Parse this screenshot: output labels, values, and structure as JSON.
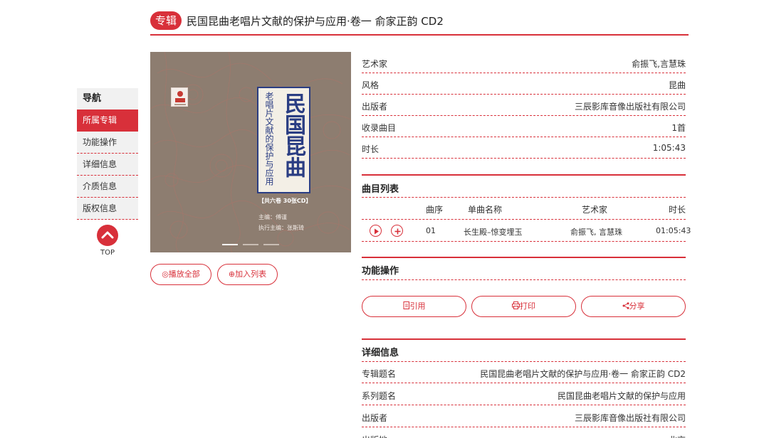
{
  "header": {
    "badge": "专辑",
    "title": "民国昆曲老唱片文献的保护与应用·卷一 俞家正韵 CD2"
  },
  "sidenav": {
    "heading": "导航",
    "items": [
      {
        "label": "所属专辑",
        "active": true
      },
      {
        "label": "功能操作",
        "active": false
      },
      {
        "label": "详细信息",
        "active": false
      },
      {
        "label": "介质信息",
        "active": false
      },
      {
        "label": "版权信息",
        "active": false
      }
    ],
    "top_label": "TOP"
  },
  "cover": {
    "main_title": "民国昆曲",
    "side_title": "老唱片文献的保护与应用",
    "volume": "【共六卷 30张CD】",
    "editor": "主编：傅谨",
    "exec_editor": "执行主编：张斯琦",
    "slides_total": 3,
    "active_slide": 1
  },
  "actions": {
    "play_all": "◎播放全部",
    "add_list": "⊕加入列表"
  },
  "info_rows": [
    {
      "key": "艺术家",
      "value": "俞振飞,言慧珠"
    },
    {
      "key": "风格",
      "value": "昆曲"
    },
    {
      "key": "出版者",
      "value": "三辰影库音像出版社有限公司"
    },
    {
      "key": "收录曲目",
      "value": "1首"
    },
    {
      "key": "时长",
      "value": "1:05:43"
    }
  ],
  "tracklist": {
    "title": "曲目列表",
    "headers": {
      "no": "曲序",
      "name": "单曲名称",
      "artist": "艺术家",
      "duration": "时长"
    },
    "rows": [
      {
        "no": "01",
        "name": "长生殿–惊变埋玉",
        "artist": "俞振飞, 言慧珠",
        "duration": "01:05:43"
      }
    ]
  },
  "functions": {
    "title": "功能操作",
    "cite": "引用",
    "print": "打印",
    "share": "分享"
  },
  "details": {
    "title": "详细信息",
    "rows": [
      {
        "key": "专辑题名",
        "value": "民国昆曲老唱片文献的保护与应用·卷一 俞家正韵 CD2"
      },
      {
        "key": "系列题名",
        "value": "民国昆曲老唱片文献的保护与应用"
      },
      {
        "key": "出版者",
        "value": "三辰影库音像出版社有限公司"
      },
      {
        "key": "出版地",
        "value": "北京"
      }
    ]
  },
  "colors": {
    "accent": "#d8303a",
    "plate_blue": "#2a3d83"
  }
}
